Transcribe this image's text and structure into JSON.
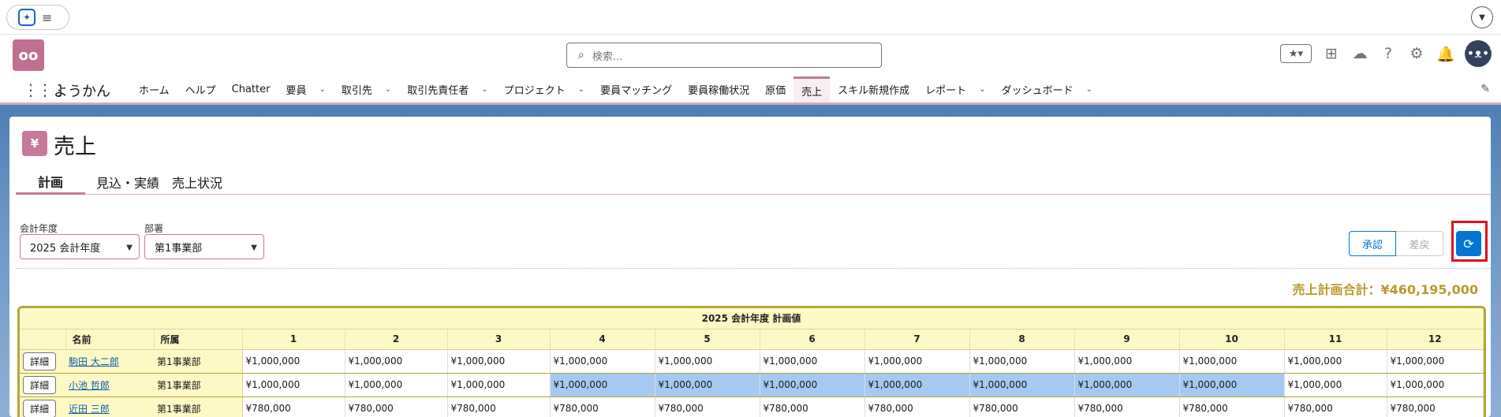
{
  "utility": {
    "spark_icon": "spark-icon",
    "menu_icon": "menu-icon"
  },
  "header": {
    "logo_icon": "glasses-logo-icon",
    "search_placeholder": "検索...",
    "icons": [
      "favorites-star-icon",
      "add-icon",
      "cloud-help-icon",
      "help-icon",
      "gear-icon",
      "bell-icon",
      "avatar-icon"
    ]
  },
  "nav": {
    "app_name": "ようかん",
    "items": [
      {
        "label": "ホーム",
        "dropdown": false
      },
      {
        "label": "ヘルプ",
        "dropdown": false
      },
      {
        "label": "Chatter",
        "dropdown": false
      },
      {
        "label": "要員",
        "dropdown": true
      },
      {
        "label": "取引先",
        "dropdown": true
      },
      {
        "label": "取引先責任者",
        "dropdown": true
      },
      {
        "label": "プロジェクト",
        "dropdown": true
      },
      {
        "label": "要員マッチング",
        "dropdown": false
      },
      {
        "label": "要員稼働状況",
        "dropdown": false
      },
      {
        "label": "原価",
        "dropdown": false
      },
      {
        "label": "売上",
        "dropdown": false,
        "active": true
      },
      {
        "label": "スキル新規作成",
        "dropdown": false
      },
      {
        "label": "レポート",
        "dropdown": true
      },
      {
        "label": "ダッシュボード",
        "dropdown": true
      }
    ]
  },
  "page": {
    "icon_label": "¥",
    "title": "売上",
    "tabs": [
      "計画",
      "見込・実績",
      "売上状況"
    ],
    "filters": {
      "fiscal_year_label": "会計年度",
      "fiscal_year_value": "2025 会計年度",
      "department_label": "部署",
      "department_value": "第1事業部"
    },
    "buttons": {
      "approve": "承認",
      "revert": "差戻"
    },
    "total": "売上計画合計：¥460,195,000"
  },
  "table": {
    "group_header": "2025 会計年度 計画値",
    "col_name": "名前",
    "col_dept": "所属",
    "months": [
      "1",
      "2",
      "3",
      "4",
      "5",
      "6",
      "7",
      "8",
      "9",
      "10",
      "11",
      "12"
    ],
    "detail_label": "詳細",
    "rows": [
      {
        "name": "駒田 大二郎",
        "dept": "第1事業部",
        "values": [
          "¥1,000,000",
          "¥1,000,000",
          "¥1,000,000",
          "¥1,000,000",
          "¥1,000,000",
          "¥1,000,000",
          "¥1,000,000",
          "¥1,000,000",
          "¥1,000,000",
          "¥1,000,000",
          "¥1,000,000",
          "¥1,000,000"
        ],
        "selected": []
      },
      {
        "name": "小池 哲郎",
        "dept": "第1事業部",
        "values": [
          "¥1,000,000",
          "¥1,000,000",
          "¥1,000,000",
          "¥1,000,000",
          "¥1,000,000",
          "¥1,000,000",
          "¥1,000,000",
          "¥1,000,000",
          "¥1,000,000",
          "¥1,000,000",
          "¥1,000,000",
          "¥1,000,000"
        ],
        "selected": [
          3,
          4,
          5,
          6,
          7,
          8,
          9
        ]
      },
      {
        "name": "近田 三郎",
        "dept": "第1事業部",
        "values": [
          "¥780,000",
          "¥780,000",
          "¥780,000",
          "¥780,000",
          "¥780,000",
          "¥780,000",
          "¥780,000",
          "¥780,000",
          "¥780,000",
          "¥780,000",
          "¥780,000",
          "¥780,000"
        ],
        "selected": []
      }
    ]
  },
  "colors": {
    "accent": "#c6799b",
    "brand_blue": "#0176d3",
    "table_header": "#fdf9c6",
    "table_border": "#b3a73c",
    "selection": "#a6c9f2",
    "highlight": "#e0121a",
    "total_text": "#b89b2c"
  }
}
